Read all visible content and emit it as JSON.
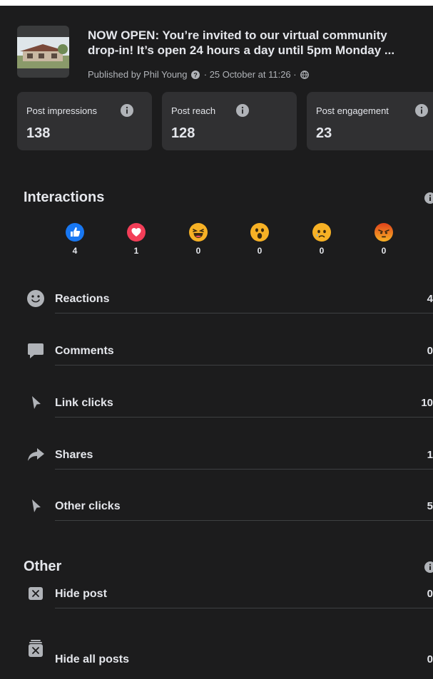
{
  "post": {
    "title_line1": "NOW OPEN: You’re invited to our virtual community",
    "title_line2": "drop-in! It’s open 24 hours a day until 5pm Monday ...",
    "published_by": "Published by Phil Young",
    "date": "· 25 October at 11:26 ·"
  },
  "stats": [
    {
      "label": "Post impressions",
      "value": "138"
    },
    {
      "label": "Post reach",
      "value": "128"
    },
    {
      "label": "Post engagement",
      "value": "23"
    }
  ],
  "interactions": {
    "title": "Interactions",
    "reactions": [
      {
        "icon": "like-icon",
        "count": "4"
      },
      {
        "icon": "love-icon",
        "count": "1"
      },
      {
        "icon": "haha-icon",
        "count": "0"
      },
      {
        "icon": "wow-icon",
        "count": "0"
      },
      {
        "icon": "sad-icon",
        "count": "0"
      },
      {
        "icon": "angry-icon",
        "count": "0"
      }
    ],
    "rows": [
      {
        "icon": "smiley-icon",
        "label": "Reactions",
        "value": "4"
      },
      {
        "icon": "comment-icon",
        "label": "Comments",
        "value": "0"
      },
      {
        "icon": "cursor-icon",
        "label": "Link clicks",
        "value": "10"
      },
      {
        "icon": "share-icon",
        "label": "Shares",
        "value": "1"
      },
      {
        "icon": "cursor-icon",
        "label": "Other clicks",
        "value": "5"
      }
    ]
  },
  "other": {
    "title": "Other",
    "rows": [
      {
        "icon": "hide-icon",
        "label": "Hide post",
        "value": "0"
      },
      {
        "icon": "hide-all-icon",
        "label": "Hide all posts",
        "value": "0"
      }
    ]
  },
  "colors": {
    "background": "#1c1c1d",
    "card": "#303032",
    "like": "#1877f2",
    "love": "#f33e58",
    "emoji_yellow": "#f7b125",
    "angry": "#e9710f"
  }
}
